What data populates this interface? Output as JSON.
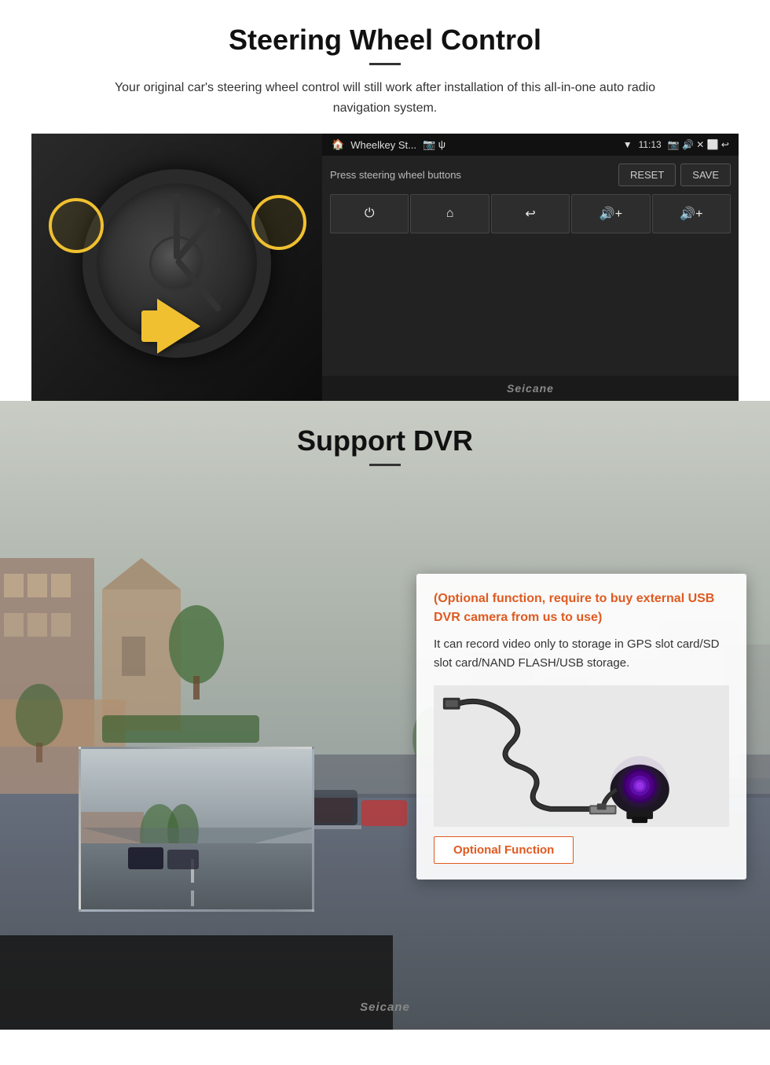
{
  "section1": {
    "title": "Steering Wheel Control",
    "description": "Your original car's steering wheel control will still work after installation of this all-in-one auto radio navigation system.",
    "android_ui": {
      "app_name": "Wheelkey St...",
      "time": "11:13",
      "prompt": "Press steering wheel buttons",
      "reset_label": "RESET",
      "save_label": "SAVE",
      "buttons": [
        "⏻",
        "⌂",
        "↩",
        "🔊+",
        "🔊+"
      ]
    },
    "watermark": "Seicane"
  },
  "section2": {
    "title": "Support DVR",
    "optional_text": "(Optional function, require to buy external USB DVR camera from us to use)",
    "description": "It can record video only to storage in GPS slot card/SD slot card/NAND FLASH/USB storage.",
    "optional_badge": "Optional Function",
    "watermark": "Seicane"
  }
}
